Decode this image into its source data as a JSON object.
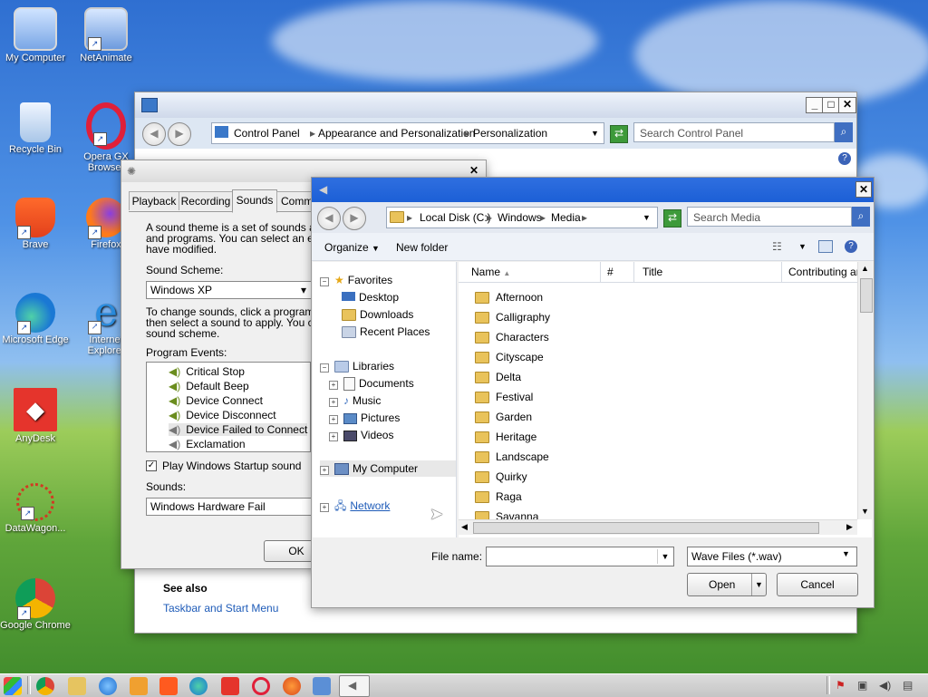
{
  "desktop": {
    "icons": [
      {
        "label": "My Computer",
        "icon": "computer-icon"
      },
      {
        "label": "NetAnimate",
        "icon": "network-computer-icon"
      },
      {
        "label": "Recycle Bin",
        "icon": "recycle-bin-icon"
      },
      {
        "label": "Opera GX Browser",
        "icon": "opera-gx-icon"
      },
      {
        "label": "Brave",
        "icon": "brave-icon"
      },
      {
        "label": "Firefox",
        "icon": "firefox-icon"
      },
      {
        "label": "Microsoft Edge",
        "icon": "edge-icon"
      },
      {
        "label": "Internet Explorer",
        "icon": "internet-explorer-icon"
      },
      {
        "label": "AnyDesk",
        "icon": "anydesk-icon"
      },
      {
        "label": "DataWagon...",
        "icon": "datawagon-icon"
      },
      {
        "label": "Google Chrome",
        "icon": "chrome-icon"
      }
    ]
  },
  "control_panel": {
    "breadcrumb": [
      "Control Panel",
      "Appearance and Personalization",
      "Personalization"
    ],
    "search_placeholder": "Search Control Panel",
    "see_also": "See also",
    "link": "Taskbar and Start Menu"
  },
  "sound_dialog": {
    "tabs": [
      "Playback",
      "Recording",
      "Sounds",
      "Comm"
    ],
    "intro": [
      "A sound theme is a set of sounds a",
      "and programs.  You can select an ex",
      "have modified."
    ],
    "scheme_label": "Sound Scheme:",
    "scheme_value": "Windows XP",
    "instructions": [
      "To change sounds, click a program",
      "then select a sound to apply.  You c",
      "sound scheme."
    ],
    "events_label": "Program Events:",
    "events": [
      "Critical Stop",
      "Default Beep",
      "Device Connect",
      "Device Disconnect",
      "Device Failed to Connect",
      "Exclamation"
    ],
    "startup_label": "Play Windows Startup sound",
    "sounds_label": "Sounds:",
    "sounds_value": "Windows Hardware Fail",
    "ok": "OK"
  },
  "open_dialog": {
    "breadcrumb": [
      "Local Disk (C:)",
      "Windows",
      "Media"
    ],
    "search_placeholder": "Search Media",
    "organize": "Organize",
    "new_folder": "New folder",
    "nav": {
      "favorites": "Favorites",
      "fav_items": [
        "Desktop",
        "Downloads",
        "Recent Places"
      ],
      "libraries": "Libraries",
      "lib_items": [
        "Documents",
        "Music",
        "Pictures",
        "Videos"
      ],
      "computer": "My Computer",
      "network": "Network"
    },
    "columns": [
      "Name",
      "#",
      "Title",
      "Contributing art"
    ],
    "folders": [
      "Afternoon",
      "Calligraphy",
      "Characters",
      "Cityscape",
      "Delta",
      "Festival",
      "Garden",
      "Heritage",
      "Landscape",
      "Quirky",
      "Raga",
      "Savanna"
    ],
    "filename_label": "File name:",
    "filename_value": "",
    "filter": "Wave Files (*.wav)",
    "open": "Open",
    "cancel": "Cancel"
  },
  "taskbar": {
    "apps": [
      "start-icon",
      "chrome-icon",
      "explorer-icon",
      "ie-icon",
      "media-icon",
      "brave-icon",
      "edge-icon",
      "anydesk-icon",
      "opera-icon",
      "firefox-icon",
      "control-panel-icon",
      "sound-icon"
    ]
  },
  "colors": {
    "title_blue": "#1c5fd6",
    "accent": "#3f6fc2"
  }
}
